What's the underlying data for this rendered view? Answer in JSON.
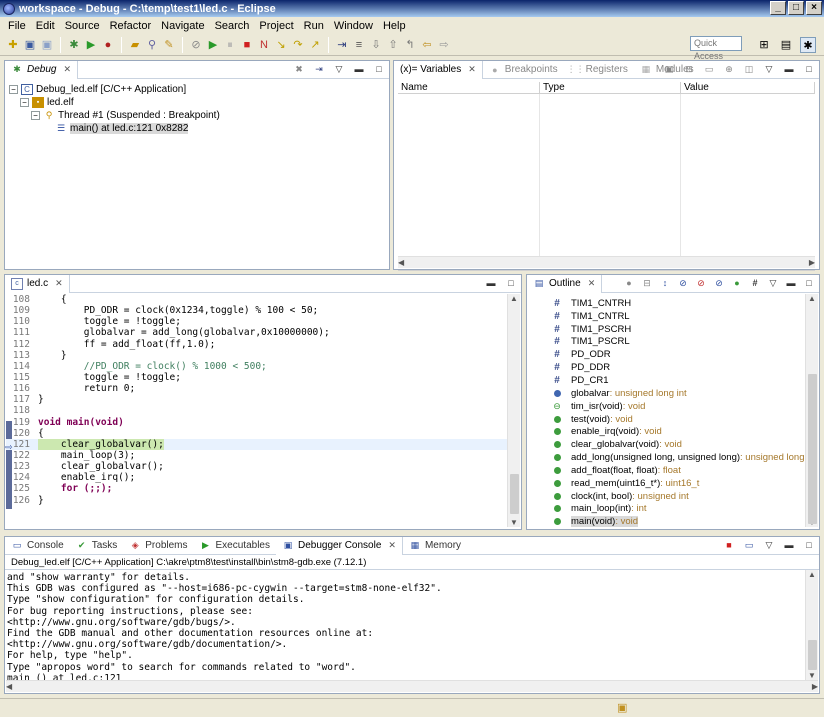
{
  "window": {
    "title": "workspace - Debug - C:\\temp\\test1\\led.c - Eclipse"
  },
  "menu": [
    "File",
    "Edit",
    "Source",
    "Refactor",
    "Navigate",
    "Search",
    "Project",
    "Run",
    "Window",
    "Help"
  ],
  "toolbar": {
    "quick_access_placeholder": "Quick Access"
  },
  "debug_view": {
    "tab": "Debug",
    "tree": [
      {
        "label": "Debug_led.elf [C/C++ Application]",
        "level": 0
      },
      {
        "label": "led.elf",
        "level": 1
      },
      {
        "label": "Thread #1 (Suspended : Breakpoint)",
        "level": 2
      },
      {
        "label": "main() at led.c:121 0x8282",
        "level": 3
      }
    ]
  },
  "variables_view": {
    "tabs": [
      "(x)= Variables",
      "Breakpoints",
      "Registers",
      "Modules"
    ],
    "columns": [
      "Name",
      "Type",
      "Value"
    ]
  },
  "editor": {
    "tab": "led.c",
    "current_line": 121,
    "lines": [
      {
        "n": "108",
        "text": "    {"
      },
      {
        "n": "109",
        "text": "        PD_ODR = clock(0x1234,toggle) % 100 < 50;"
      },
      {
        "n": "110",
        "text": "        toggle = !toggle;"
      },
      {
        "n": "111",
        "text": "        globalvar = add_long(globalvar,0x10000000);"
      },
      {
        "n": "112",
        "text": "        ff = add_float(ff,1.0);"
      },
      {
        "n": "113",
        "text": "    }"
      },
      {
        "n": "114",
        "text": "        //PD_ODR = clock() % 1000 < 500;"
      },
      {
        "n": "115",
        "text": "        toggle = !toggle;"
      },
      {
        "n": "116",
        "text": "        return 0;"
      },
      {
        "n": "117",
        "text": "}"
      },
      {
        "n": "118",
        "text": ""
      },
      {
        "n": "119",
        "text": "void main(void)"
      },
      {
        "n": "120",
        "text": "{"
      },
      {
        "n": "121",
        "text": "    clear_globalvar();"
      },
      {
        "n": "122",
        "text": "    main_loop(3);"
      },
      {
        "n": "123",
        "text": "    clear_globalvar();"
      },
      {
        "n": "124",
        "text": "    enable_irq();"
      },
      {
        "n": "125",
        "text": "    for (;;);"
      },
      {
        "n": "126",
        "text": "}"
      }
    ]
  },
  "outline_view": {
    "tab": "Outline",
    "items": [
      {
        "kind": "macro",
        "name": "TIM1_CNTRH",
        "type": ""
      },
      {
        "kind": "macro",
        "name": "TIM1_CNTRL",
        "type": ""
      },
      {
        "kind": "macro",
        "name": "TIM1_PSCRH",
        "type": ""
      },
      {
        "kind": "macro",
        "name": "TIM1_PSCRL",
        "type": ""
      },
      {
        "kind": "macro",
        "name": "PD_ODR",
        "type": ""
      },
      {
        "kind": "macro",
        "name": "PD_DDR",
        "type": ""
      },
      {
        "kind": "macro",
        "name": "PD_CR1",
        "type": ""
      },
      {
        "kind": "var",
        "name": "globalvar",
        "type": " : unsigned long int"
      },
      {
        "kind": "decl",
        "name": "tim_isr(void)",
        "type": " : void"
      },
      {
        "kind": "func",
        "name": "test(void)",
        "type": " : void"
      },
      {
        "kind": "func",
        "name": "enable_irq(void)",
        "type": " : void"
      },
      {
        "kind": "func",
        "name": "clear_globalvar(void)",
        "type": " : void"
      },
      {
        "kind": "func",
        "name": "add_long(unsigned long, unsigned long)",
        "type": " : unsigned long int"
      },
      {
        "kind": "func",
        "name": "add_float(float, float)",
        "type": " : float"
      },
      {
        "kind": "func",
        "name": "read_mem(uint16_t*)",
        "type": " : uint16_t"
      },
      {
        "kind": "func",
        "name": "clock(int, bool)",
        "type": " : unsigned int"
      },
      {
        "kind": "func",
        "name": "main_loop(int)",
        "type": " : int"
      },
      {
        "kind": "func",
        "name": "main(void)",
        "type": " : void"
      }
    ]
  },
  "console_view": {
    "tabs": [
      "Console",
      "Tasks",
      "Problems",
      "Executables",
      "Debugger Console",
      "Memory"
    ],
    "subtitle": "Debug_led.elf [C/C++ Application] C:\\akre\\ptm8\\test\\install\\bin\\stm8-gdb.exe (7.12.1)",
    "lines": [
      "and \"show warranty\" for details.",
      "This GDB was configured as \"--host=i686-pc-cygwin --target=stm8-none-elf32\".",
      "Type \"show configuration\" for configuration details.",
      "For bug reporting instructions, please see:",
      "<http://www.gnu.org/software/gdb/bugs/>.",
      "Find the GDB manual and other documentation resources online at:",
      "<http://www.gnu.org/software/gdb/documentation/>.",
      "For help, type \"help\".",
      "Type \"apropos word\" to search for commands related to \"word\".",
      "main () at led.c:121"
    ]
  }
}
